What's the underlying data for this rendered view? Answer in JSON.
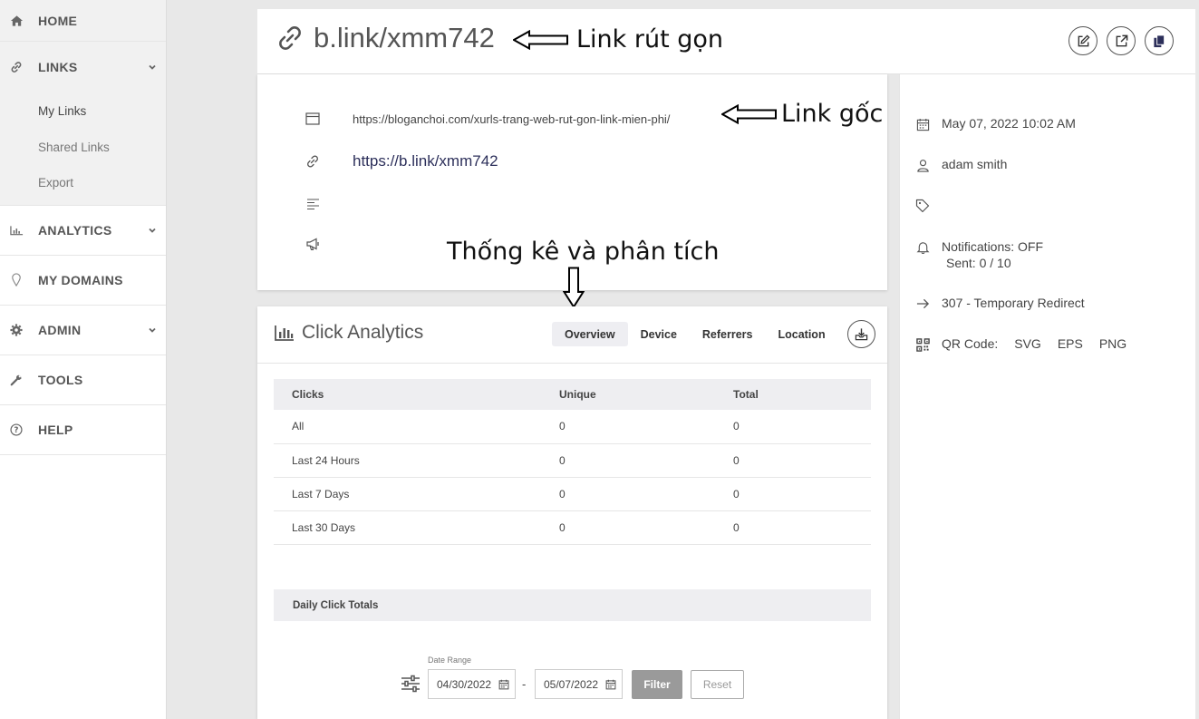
{
  "sidebar": {
    "items": [
      {
        "label": "HOME",
        "icon": "home-icon"
      },
      {
        "label": "LINKS",
        "icon": "link-icon"
      },
      {
        "label": "ANALYTICS",
        "icon": "bar-chart-icon"
      },
      {
        "label": "MY DOMAINS",
        "icon": "map-pin-icon"
      },
      {
        "label": "ADMIN",
        "icon": "gear-icon"
      },
      {
        "label": "TOOLS",
        "icon": "wrench-icon"
      },
      {
        "label": "HELP",
        "icon": "question-circle-icon"
      }
    ],
    "links_sub": [
      "My Links",
      "Shared Links",
      "Export"
    ]
  },
  "header": {
    "title": "b.link/xmm742",
    "annotation": "Link rút gọn"
  },
  "link_info": {
    "original_url": "https://bloganchoi.com/xurls-trang-web-rut-gon-link-mien-phi/",
    "original_annotation": "Link gốc",
    "short_url": "https://b.link/xmm742",
    "analytics_annotation": "Thống kê và phân tích"
  },
  "details": {
    "date": "May 07, 2022 10:02 AM",
    "owner": "adam smith",
    "notifications": "Notifications: OFF",
    "sent": "Sent: 0 / 10",
    "redirect": "307 - Temporary Redirect",
    "qr_label": "QR Code:",
    "qr_formats": [
      "SVG",
      "EPS",
      "PNG"
    ]
  },
  "analytics": {
    "title": "Click Analytics",
    "tabs": [
      "Overview",
      "Device",
      "Referrers",
      "Location"
    ],
    "table": {
      "headers": [
        "Clicks",
        "Unique",
        "Total"
      ],
      "rows": [
        [
          "All",
          "0",
          "0"
        ],
        [
          "Last 24 Hours",
          "0",
          "0"
        ],
        [
          "Last 7 Days",
          "0",
          "0"
        ],
        [
          "Last 30 Days",
          "0",
          "0"
        ]
      ]
    },
    "daily_title": "Daily Click Totals",
    "filter": {
      "label": "Date Range",
      "start": "04/30/2022",
      "end": "05/07/2022",
      "separator": "-",
      "filter_label": "Filter",
      "reset_label": "Reset"
    }
  },
  "colors": {
    "accent": "#2c2f5a",
    "sidebar_active_bg": "#f1f1f1",
    "filter_button": "#9a9a9a"
  }
}
